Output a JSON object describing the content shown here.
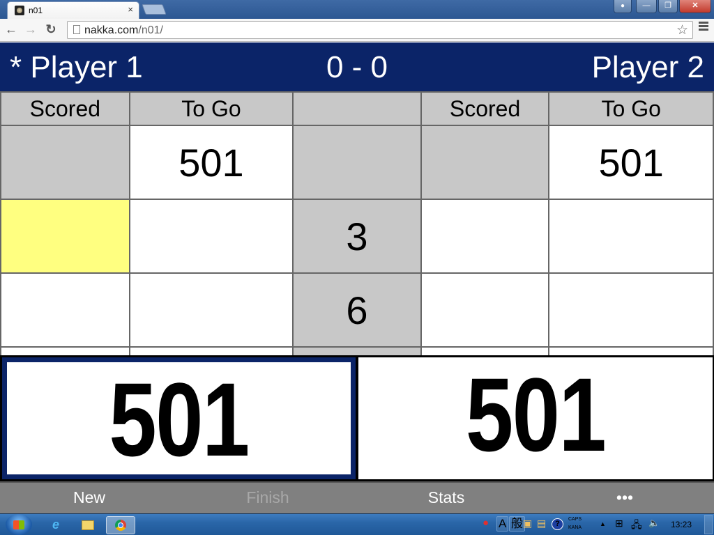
{
  "browser": {
    "tab_title": "n01",
    "tab_close": "×",
    "url_host": "nakka.com",
    "url_path": "/n01/",
    "icons": {
      "back": "←",
      "forward": "→",
      "reload": "↻",
      "star": "☆",
      "minimize": "—",
      "maximize": "❐",
      "close": "✕",
      "user": "👤"
    }
  },
  "game": {
    "player1": "* Player 1",
    "player2": "Player 2",
    "legs_score": "0 - 0",
    "columns": {
      "p1_scored": "Scored",
      "p1_togo": "To Go",
      "middle": "",
      "p2_scored": "Scored",
      "p2_togo": "To Go"
    },
    "rows": [
      {
        "p1_scored": "",
        "p1_togo": "501",
        "darts": "",
        "p2_scored": "",
        "p2_togo": "501"
      },
      {
        "p1_scored": "",
        "p1_togo": "",
        "darts": "3",
        "p2_scored": "",
        "p2_togo": ""
      },
      {
        "p1_scored": "",
        "p1_togo": "",
        "darts": "6",
        "p2_scored": "",
        "p2_togo": ""
      },
      {
        "p1_scored": "",
        "p1_togo": "",
        "darts": "",
        "p2_scored": "",
        "p2_togo": ""
      }
    ],
    "p1_remaining": "501",
    "p2_remaining": "501",
    "active_player": 1,
    "colors": {
      "header_bg": "#0b2468",
      "input_highlight": "#ffff80",
      "cell_gray": "#c8c8c8",
      "footer_bg": "#808080"
    }
  },
  "footer": {
    "new": "New",
    "finish": "Finish",
    "stats": "Stats",
    "more": "•••"
  },
  "taskbar": {
    "ime_mode": "A",
    "ime_kanji": "般",
    "caps": "CAPS",
    "kana": "KANA",
    "help": "?",
    "tray_up": "▲",
    "clock": "13:23"
  }
}
